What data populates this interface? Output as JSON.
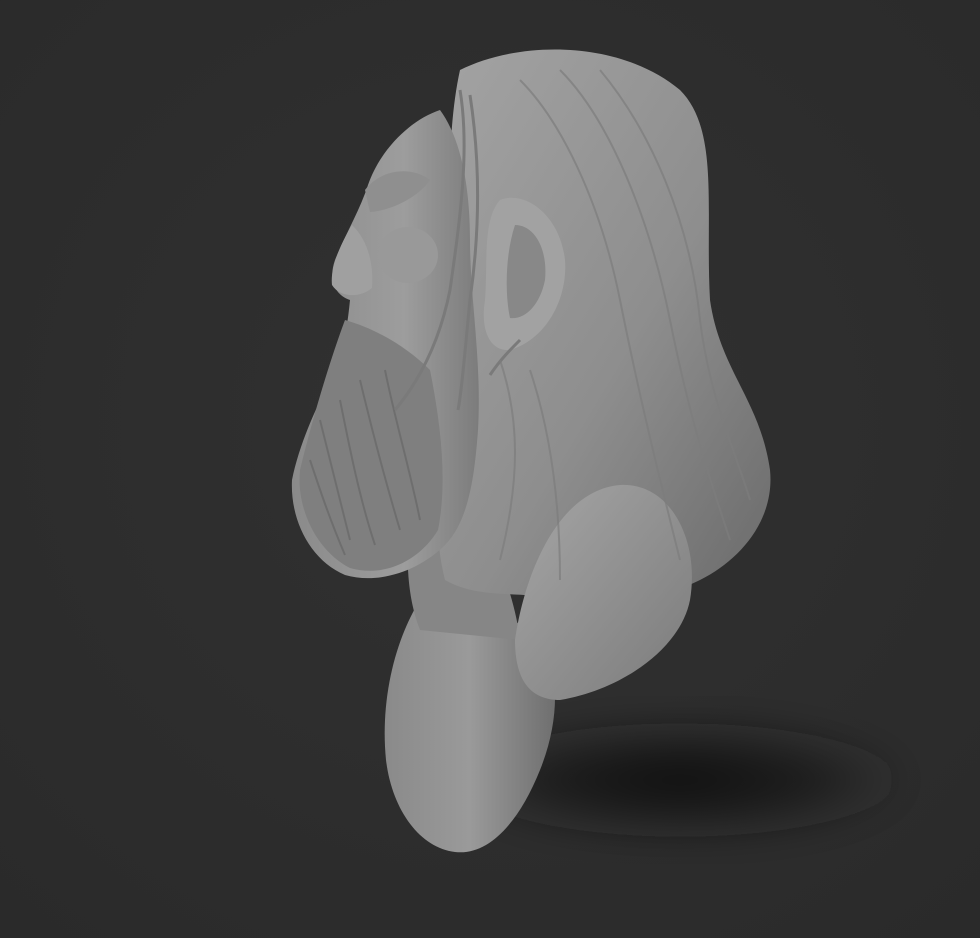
{
  "scene": {
    "subject": "sculpt-render",
    "colors": {
      "background": "#2d2d2d",
      "clay_light": "#9c9c9c",
      "clay_mid": "#878787",
      "clay_dark": "#5e5e5e",
      "shadow": "#141414"
    }
  }
}
